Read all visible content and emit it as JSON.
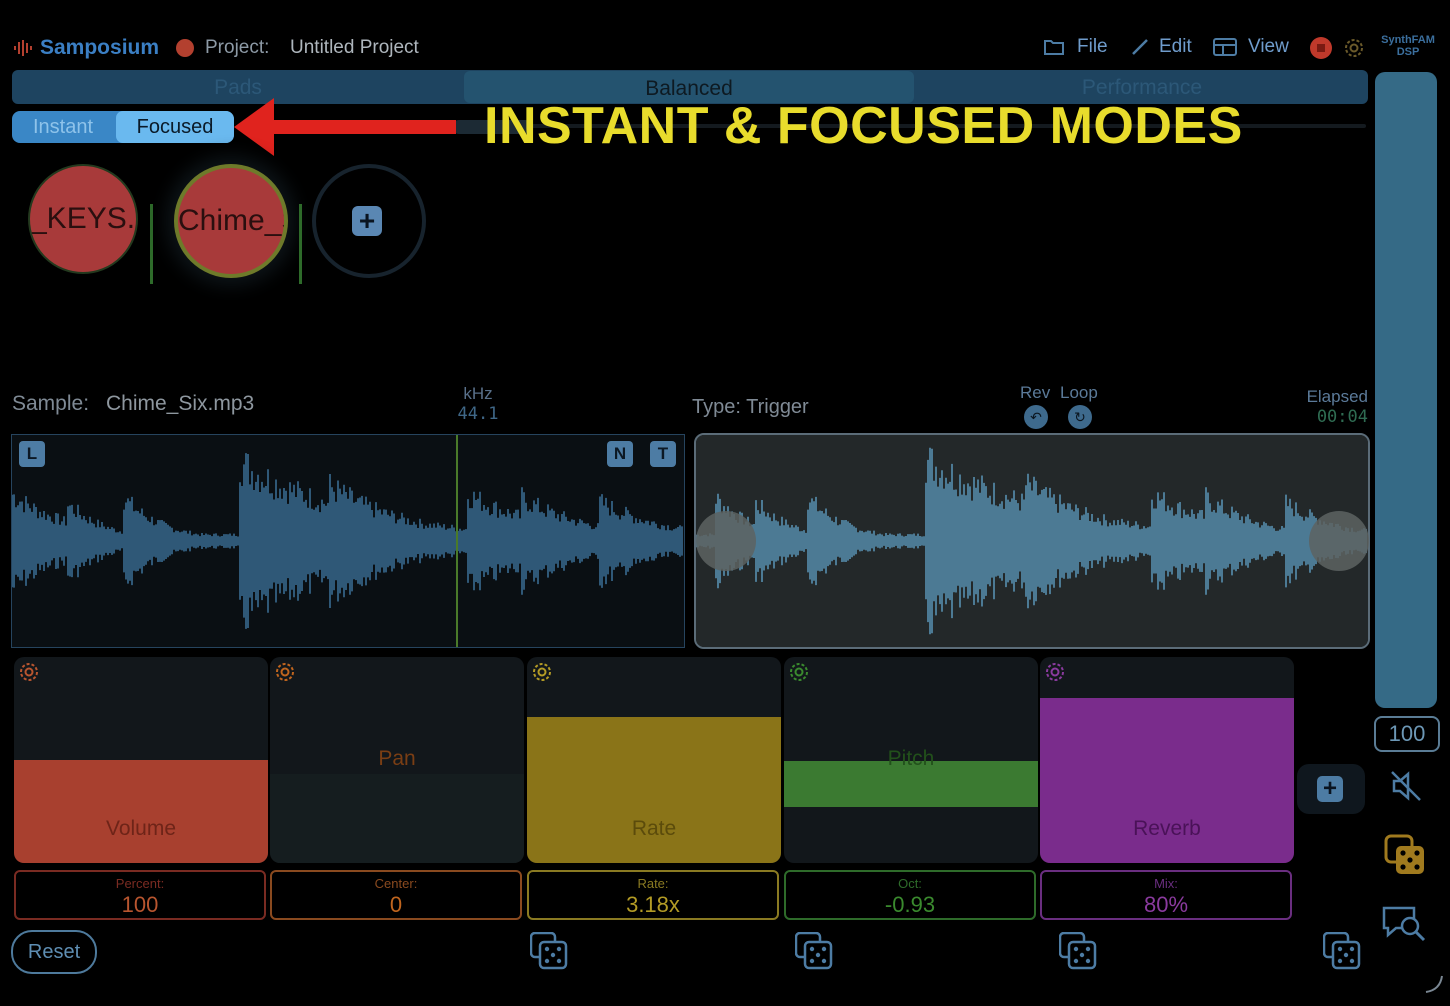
{
  "app": {
    "name": "Samposium",
    "project_label": "Project:",
    "project_name": "Untitled Project",
    "brand_text_top": "SynthFAM",
    "brand_text_bottom": "DSP"
  },
  "menu": {
    "file": "File",
    "edit": "Edit",
    "view": "View"
  },
  "tabs": [
    "Pads",
    "Balanced",
    "Performance"
  ],
  "mode_toggle": {
    "instant": "Instant",
    "focused": "Focused",
    "selected": "Focused"
  },
  "annotation": "INSTANT & FOCUSED MODES",
  "pads": [
    {
      "label": "_KEYS.m"
    },
    {
      "label": "Chime_S"
    }
  ],
  "sample": {
    "label": "Sample:",
    "name": "Chime_Six.mp3",
    "khz_label": "kHz",
    "khz_value": "44.1",
    "type": "Type: Trigger",
    "rev": "Rev",
    "loop": "Loop",
    "elapsed_label": "Elapsed",
    "elapsed_value": "00:04",
    "chip_l": "L",
    "chip_n": "N",
    "chip_t": "T"
  },
  "controls": [
    {
      "name": "Volume",
      "caption": "Percent:",
      "value": "100",
      "level": 0.5,
      "color": "#a8402f",
      "border": "#7a2b22",
      "gear": "#b8552f",
      "text": "#6e2418"
    },
    {
      "name": "Pan",
      "caption": "Center:",
      "value": "0",
      "level": 0.43,
      "color": "#151d1f",
      "border": "#8a4a1f",
      "gear": "#c0651e",
      "text": "#7a3e14"
    },
    {
      "name": "Rate",
      "caption": "Rate:",
      "value": "3.18x",
      "level": 0.71,
      "color": "#8a7418",
      "border": "#8a7a22",
      "gear": "#b39b25",
      "text": "#5b4b0b"
    },
    {
      "name": "Pitch",
      "caption": "Oct:",
      "value": "-0.93",
      "level": 0.27,
      "color": "#3b7a31",
      "border": "#2e6b2a",
      "gear": "#3a8a2e",
      "text": "#22501b"
    },
    {
      "name": "Reverb",
      "caption": "Mix:",
      "value": "80%",
      "level": 0.8,
      "color": "#7a2c8c",
      "border": "#6a2e80",
      "gear": "#8a3a9e",
      "text": "#4a1258"
    }
  ],
  "reset_label": "Reset",
  "master": {
    "value": "100",
    "level": 1.0
  }
}
